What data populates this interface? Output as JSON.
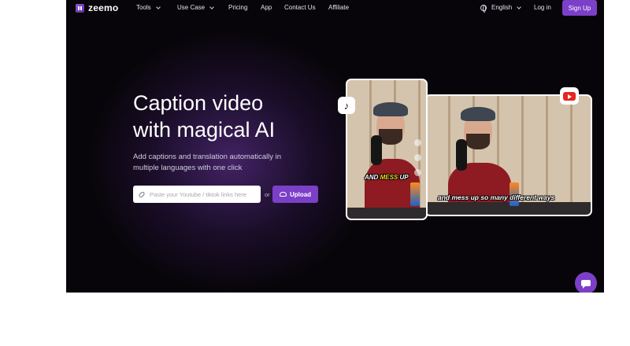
{
  "nav": {
    "brand": "zeemo",
    "items": [
      {
        "label": "Tools",
        "dropdown": true
      },
      {
        "label": "Use Case",
        "dropdown": true
      },
      {
        "label": "Pricing",
        "dropdown": false
      },
      {
        "label": "App",
        "dropdown": false
      },
      {
        "label": "Contact Us",
        "dropdown": false
      },
      {
        "label": "Affiliate",
        "dropdown": false
      }
    ],
    "language": "English",
    "login": "Log in",
    "signup": "Sign Up"
  },
  "hero": {
    "title_line1": "Caption video",
    "title_line2": "with magical AI",
    "subtitle": "Add captions and translation automatically in multiple languages with one click",
    "input_placeholder": "Paste your Youtube / tiktok links here",
    "or_text": "or",
    "upload_label": "Upload"
  },
  "previews": {
    "portrait": {
      "platform_icon": "tiktok-icon",
      "caption_before": "AND ",
      "caption_highlight": "MESS",
      "caption_after": " UP"
    },
    "wide": {
      "platform_icon": "youtube-icon",
      "caption": "and mess up so many different ways"
    }
  },
  "colors": {
    "accent": "#7c3fc8",
    "background": "#070509",
    "caption_highlight": "#f5d327"
  }
}
